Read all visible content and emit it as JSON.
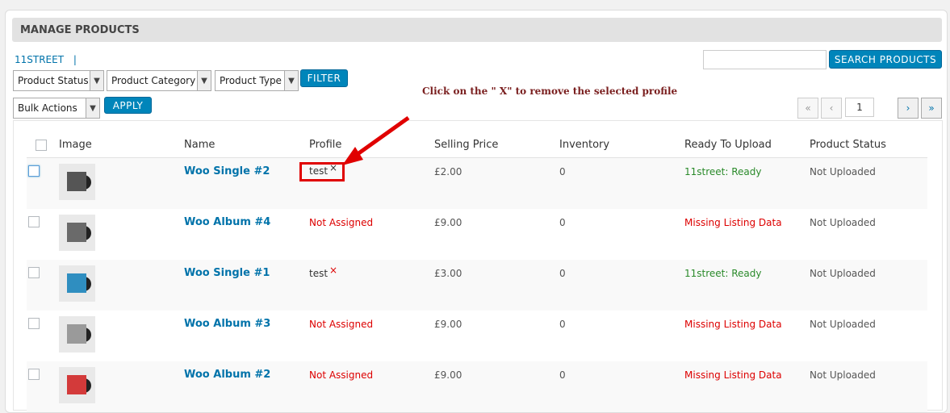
{
  "header": {
    "title": "MANAGE PRODUCTS"
  },
  "subnav": {
    "store_link": "11STREET",
    "separator": "|"
  },
  "search": {
    "button_label": "SEARCH PRODUCTS",
    "value": ""
  },
  "filters": {
    "product_status": "Product Status",
    "product_category": "Product Category",
    "product_type": "Product Type",
    "filter_button": "FILTER"
  },
  "bulk": {
    "selected": "Bulk Actions",
    "apply_button": "APPLY"
  },
  "annotation": "Click on the \" X\" to remove the selected profile",
  "pagination": {
    "first": "«",
    "prev": "‹",
    "current_page": "1",
    "next": "›",
    "last": "»"
  },
  "table": {
    "columns": [
      "Image",
      "Name",
      "Profile",
      "Selling Price",
      "Inventory",
      "Ready To Upload",
      "Product Status"
    ],
    "rows": [
      {
        "name": "Woo Single #2",
        "profile": "test",
        "price": "£2.00",
        "inventory": "0",
        "ready": "11street: Ready",
        "status": "Not Uploaded",
        "thumb_color": "#555555"
      },
      {
        "name": "Woo Album #4",
        "profile": "Not Assigned",
        "price": "£9.00",
        "inventory": "0",
        "ready": "Missing Listing Data",
        "status": "Not Uploaded",
        "thumb_color": "#6a6a6a"
      },
      {
        "name": "Woo Single #1",
        "profile": "test",
        "price": "£3.00",
        "inventory": "0",
        "ready": "11street: Ready",
        "status": "Not Uploaded",
        "thumb_color": "#2f8ec0"
      },
      {
        "name": "Woo Album #3",
        "profile": "Not Assigned",
        "price": "£9.00",
        "inventory": "0",
        "ready": "Missing Listing Data",
        "status": "Not Uploaded",
        "thumb_color": "#9a9a9a"
      },
      {
        "name": "Woo Album #2",
        "profile": "Not Assigned",
        "price": "£9.00",
        "inventory": "0",
        "ready": "Missing Listing Data",
        "status": "Not Uploaded",
        "thumb_color": "#d33a3a"
      }
    ]
  },
  "icons": {
    "remove": "×",
    "dropdown": "chevron-down-icon"
  }
}
